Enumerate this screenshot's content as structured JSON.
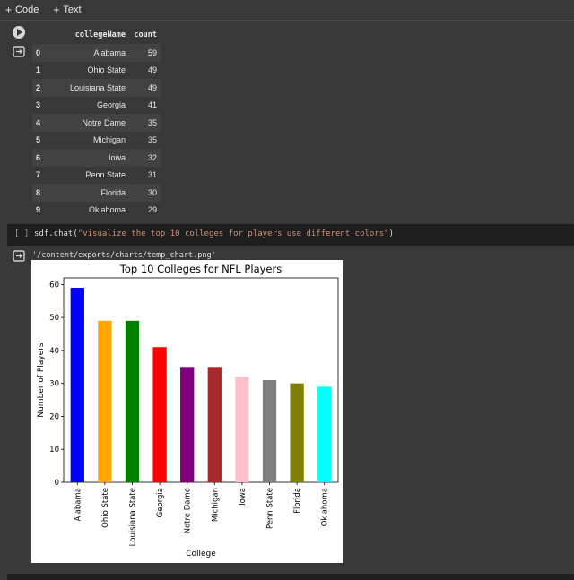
{
  "toolbar": {
    "code_label": "Code",
    "text_label": "Text"
  },
  "table": {
    "headers": [
      "collegeName",
      "count"
    ],
    "rows": [
      {
        "idx": "0",
        "name": "Alabama",
        "count": "59"
      },
      {
        "idx": "1",
        "name": "Ohio State",
        "count": "49"
      },
      {
        "idx": "2",
        "name": "Louisiana State",
        "count": "49"
      },
      {
        "idx": "3",
        "name": "Georgia",
        "count": "41"
      },
      {
        "idx": "4",
        "name": "Notre Dame",
        "count": "35"
      },
      {
        "idx": "5",
        "name": "Michigan",
        "count": "35"
      },
      {
        "idx": "6",
        "name": "Iowa",
        "count": "32"
      },
      {
        "idx": "7",
        "name": "Penn State",
        "count": "31"
      },
      {
        "idx": "8",
        "name": "Florida",
        "count": "30"
      },
      {
        "idx": "9",
        "name": "Oklahoma",
        "count": "29"
      }
    ]
  },
  "code_cell": {
    "bracket": "[ ]",
    "code_prefix": "sdf.chat(",
    "code_string": "\"visualize the top 10 colleges for players use different colors\"",
    "code_suffix": ")"
  },
  "output_path": "'/content/exports/charts/temp_chart.png'",
  "chart_data": {
    "type": "bar",
    "title": "Top 10 Colleges for NFL Players",
    "xlabel": "College",
    "ylabel": "Number of Players",
    "categories": [
      "Alabama",
      "Ohio State",
      "Louisiana State",
      "Georgia",
      "Notre Dame",
      "Michigan",
      "Iowa",
      "Penn State",
      "Florida",
      "Oklahoma"
    ],
    "values": [
      59,
      49,
      49,
      41,
      35,
      35,
      32,
      31,
      30,
      29
    ],
    "colors": [
      "#0000ff",
      "#ffa500",
      "#008000",
      "#ff0000",
      "#800080",
      "#a52a2a",
      "#ffc0cb",
      "#808080",
      "#808000",
      "#00ffff"
    ],
    "ylim": [
      0,
      62
    ],
    "yticks": [
      0,
      10,
      20,
      30,
      40,
      50,
      60
    ],
    "grid": false,
    "legend": "none"
  }
}
